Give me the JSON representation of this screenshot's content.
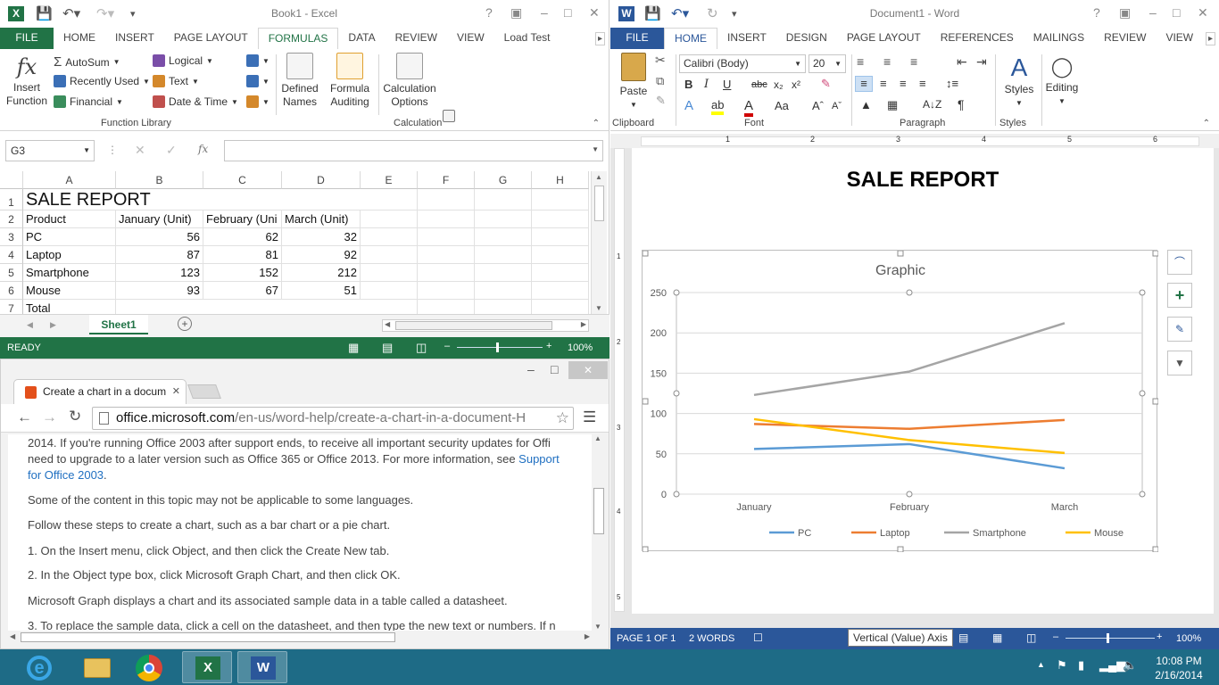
{
  "excel": {
    "window_title": "Book1 - Excel",
    "tabs": [
      "FILE",
      "HOME",
      "INSERT",
      "PAGE LAYOUT",
      "FORMULAS",
      "DATA",
      "REVIEW",
      "VIEW",
      "Load Test"
    ],
    "active_tab": "FORMULAS",
    "ribbon": {
      "insert_function": [
        "Insert",
        "Function"
      ],
      "autosum": "AutoSum",
      "recently_used": "Recently Used",
      "financial": "Financial",
      "logical": "Logical",
      "text": "Text",
      "date_time": "Date & Time",
      "defined_names": [
        "Defined",
        "Names"
      ],
      "formula_auditing": [
        "Formula",
        "Auditing"
      ],
      "calculation_options": [
        "Calculation",
        "Options"
      ],
      "group_function_library": "Function Library",
      "group_calculation": "Calculation"
    },
    "name_box": "G3",
    "columns": [
      "A",
      "B",
      "C",
      "D",
      "E",
      "F",
      "G",
      "H"
    ],
    "rows": [
      "1",
      "2",
      "3",
      "4",
      "5",
      "6",
      "7"
    ],
    "title_cell": "SALE REPORT",
    "headers": [
      "Product",
      "January (Unit)",
      "February (Uni",
      "March (Unit)"
    ],
    "data": [
      [
        "PC",
        "56",
        "62",
        "32"
      ],
      [
        "Laptop",
        "87",
        "81",
        "92"
      ],
      [
        "Smartphone",
        "123",
        "152",
        "212"
      ],
      [
        "Mouse",
        "93",
        "67",
        "51"
      ]
    ],
    "row7_label": "Total",
    "sheet_tab": "Sheet1",
    "status": "READY",
    "zoom": "100%"
  },
  "word": {
    "window_title": "Document1 - Word",
    "tabs": [
      "FILE",
      "HOME",
      "INSERT",
      "DESIGN",
      "PAGE LAYOUT",
      "REFERENCES",
      "MAILINGS",
      "REVIEW",
      "VIEW"
    ],
    "active_tab": "HOME",
    "font_name": "Calibri (Body)",
    "font_size": "20",
    "groups": {
      "clipboard": "Clipboard",
      "font": "Font",
      "paragraph": "Paragraph",
      "styles": "Styles"
    },
    "paste_label": "Paste",
    "styles_label": "Styles",
    "editing_label": "Editing",
    "ruler_numbers": [
      "1",
      "2",
      "3",
      "4",
      "5",
      "6"
    ],
    "vruler_numbers": [
      "1",
      "2",
      "3",
      "4",
      "5"
    ],
    "doc_title": "SALE REPORT",
    "status_page": "PAGE 1 OF 1",
    "status_words": "2 WORDS",
    "tooltip": "Vertical (Value) Axis",
    "zoom": "100%"
  },
  "chart_data": {
    "type": "line",
    "title": "Graphic",
    "categories": [
      "January",
      "February",
      "March"
    ],
    "ylim": [
      0,
      250
    ],
    "yticks": [
      0,
      50,
      100,
      150,
      200,
      250
    ],
    "grid": true,
    "legend": "bottom",
    "series": [
      {
        "name": "PC",
        "values": [
          56,
          62,
          32
        ],
        "color": "#5b9bd5"
      },
      {
        "name": "Laptop",
        "values": [
          87,
          81,
          92
        ],
        "color": "#ed7d31"
      },
      {
        "name": "Smartphone",
        "values": [
          123,
          152,
          212
        ],
        "color": "#a5a5a5"
      },
      {
        "name": "Mouse",
        "values": [
          93,
          67,
          51
        ],
        "color": "#ffc000"
      }
    ]
  },
  "browser": {
    "tab_title": "Create a chart in a docum",
    "url_host": "office.microsoft.com",
    "url_path": "/en-us/word-help/create-a-chart-in-a-document-H",
    "para1_line1": "2014. If you're running Office 2003 after support ends, to receive all important security updates for Offi",
    "para1_line2_a": "need to upgrade to a later version such as Office 365 or Office 2013. For more information, see ",
    "para1_link1": "Support",
    "para1_link2": "for Office 2003",
    "para1_end": ".",
    "para2": "Some of the content in this topic may not be applicable to some languages.",
    "para3": "Follow these steps to create a chart, such as a bar chart or a pie chart.",
    "step1": "1.  On the Insert menu, click Object, and then click the Create New tab.",
    "step2": "2.  In the Object type box, click Microsoft Graph Chart, and then click OK.",
    "para4": "Microsoft Graph displays a chart and its associated sample data in a table called a datasheet.",
    "step3": "3.  To replace the sample data, click a cell on the datasheet, and then type the new text or numbers. If n"
  },
  "taskbar": {
    "time": "10:08 PM",
    "date": "2/16/2014"
  },
  "colors": {
    "excel_green": "#217346",
    "word_blue": "#2b579a",
    "taskbar": "#1e6b86"
  }
}
